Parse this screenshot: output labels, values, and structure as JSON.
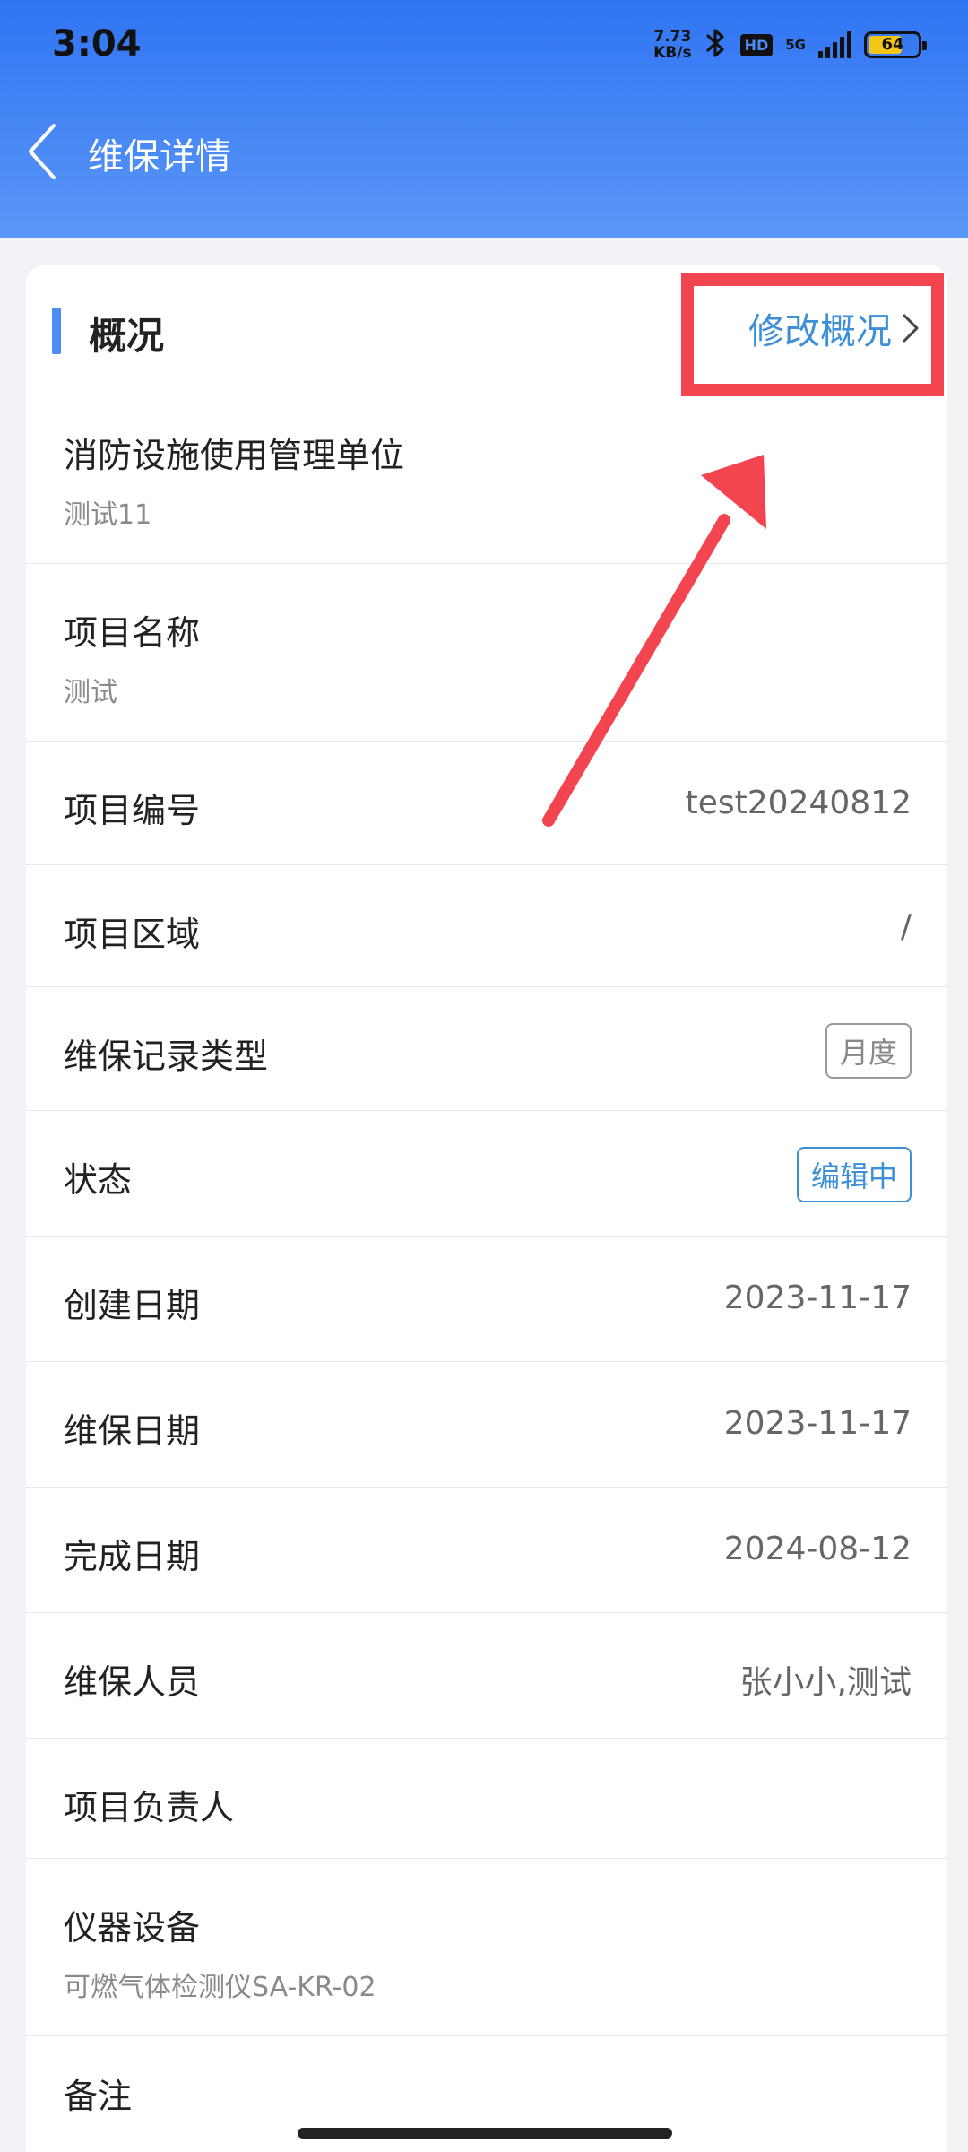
{
  "status_bar": {
    "time": "3:04",
    "net_speed_value": "7.73",
    "net_speed_unit": "KB/s",
    "hd": "HD",
    "network": "5G",
    "battery": "64"
  },
  "nav": {
    "title": "维保详情",
    "back_icon": "chevron-left-icon"
  },
  "section": {
    "title": "概况",
    "edit_label": "修改概况",
    "accent_color": "#4f8df5",
    "link_color": "#3d8fd6"
  },
  "rows": {
    "unit": {
      "label": "消防设施使用管理单位",
      "value": "测试11"
    },
    "project_name": {
      "label": "项目名称",
      "value": "测试"
    },
    "project_no": {
      "label": "项目编号",
      "value": "test20240812"
    },
    "project_area": {
      "label": "项目区域",
      "value": "/"
    },
    "record_type": {
      "label": "维保记录类型",
      "value": "月度"
    },
    "status": {
      "label": "状态",
      "value": "编辑中"
    },
    "create_date": {
      "label": "创建日期",
      "value": "2023-11-17"
    },
    "maintain_date": {
      "label": "维保日期",
      "value": "2023-11-17"
    },
    "finish_date": {
      "label": "完成日期",
      "value": "2024-08-12"
    },
    "staff": {
      "label": "维保人员",
      "value": "张小小,测试"
    },
    "leader": {
      "label": "项目负责人",
      "value": ""
    },
    "equipment": {
      "label": "仪器设备",
      "value": "可燃气体检测仪SA-KR-02"
    },
    "remark": {
      "label": "备注"
    }
  },
  "annotation_color": "#f2454f"
}
